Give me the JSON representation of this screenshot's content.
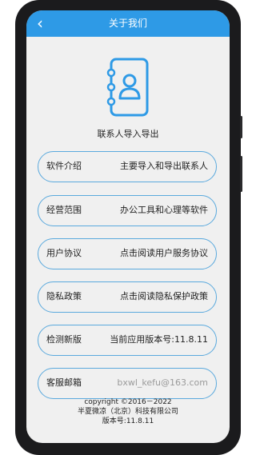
{
  "header": {
    "title": "关于我们",
    "back_icon": "back-arrow-icon"
  },
  "app": {
    "name": "联系人导入导出",
    "logo_icon": "contact-book-icon",
    "accent": "#2e9ae6"
  },
  "rows": [
    {
      "label": "软件介绍",
      "value": "主要导入和导出联系人"
    },
    {
      "label": "经营范围",
      "value": "办公工具和心理等软件"
    },
    {
      "label": "用户协议",
      "value": "点击阅读用户服务协议"
    },
    {
      "label": "隐私政策",
      "value": "点击阅读隐私保护政策"
    },
    {
      "label": "检测新版",
      "value": "当前应用版本号:11.8.11"
    },
    {
      "label": "客服邮箱",
      "value": "bxwl_kefu@163.com"
    }
  ],
  "footer": {
    "copyright": "copyright  ©2016－2022",
    "company": "半夏微凉（北京）科技有限公司",
    "version": "版本号:11.8.11"
  }
}
